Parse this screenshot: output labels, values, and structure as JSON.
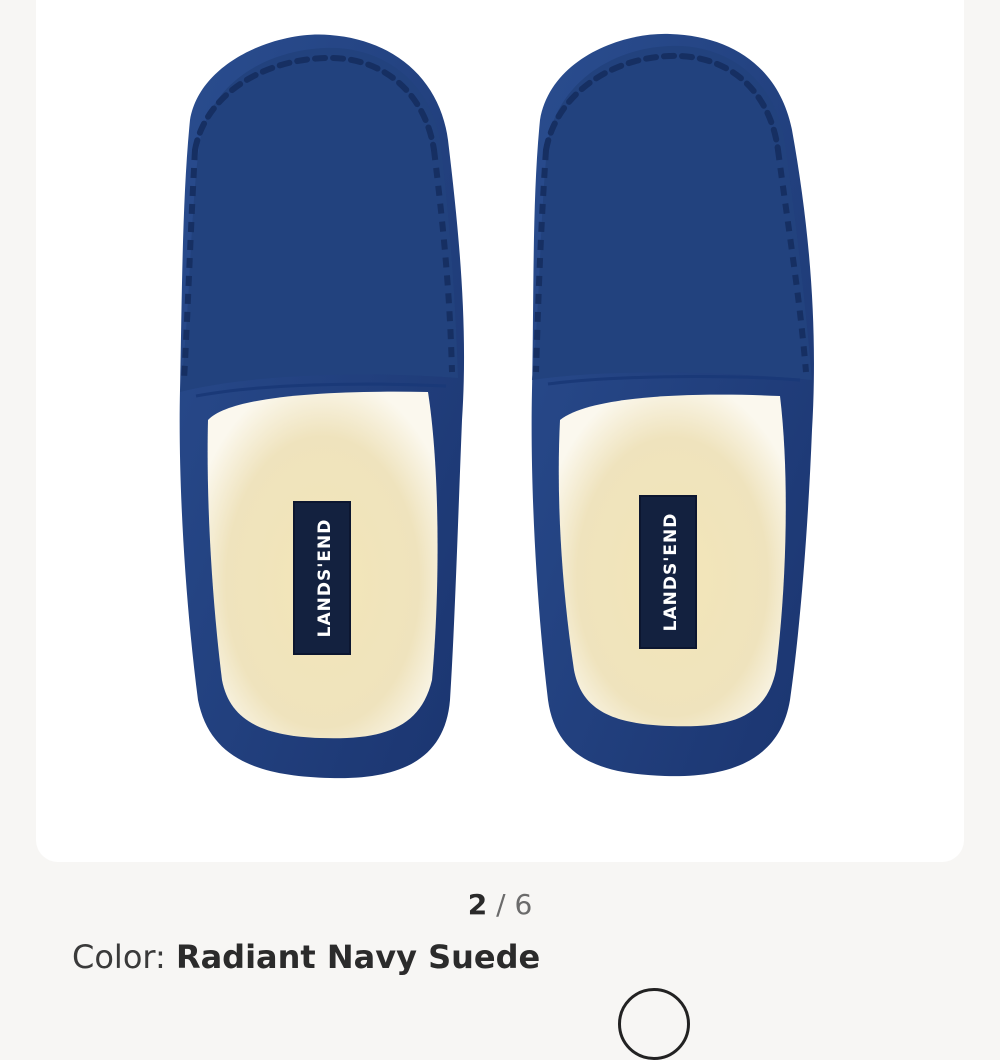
{
  "gallery": {
    "product_image_name": "moccasin-slippers-photo",
    "brand_label_left": "LANDS'END",
    "brand_label_right": "LANDS'END",
    "current_index": "2",
    "separator": "/",
    "total_count": "6"
  },
  "product": {
    "color_label": "Color:",
    "color_value": "Radiant Navy Suede"
  },
  "colors": {
    "suede": "#22427e",
    "suede_dark": "#18326a",
    "lining": "#f3e9c4",
    "label": "#13213f"
  }
}
